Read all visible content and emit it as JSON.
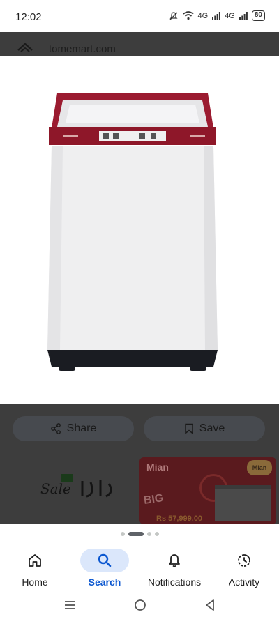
{
  "status_bar": {
    "time": "12:02",
    "network_1": "4G",
    "network_2": "4G",
    "battery": "80"
  },
  "source": {
    "site": "tomemart.com"
  },
  "actions": {
    "share_label": "Share",
    "save_label": "Save"
  },
  "related": {
    "sale_text": "Sale",
    "mian_title": "Mian",
    "mian_badge": "Mian",
    "mian_big": "BIG",
    "mian_price": "Rs 57,999.00"
  },
  "pager": {
    "count": 4,
    "active_index": 1
  },
  "bottom_nav": {
    "items": [
      {
        "label": "Home",
        "icon": "home-icon"
      },
      {
        "label": "Search",
        "icon": "search-icon",
        "active": true
      },
      {
        "label": "Notifications",
        "icon": "bell-icon"
      },
      {
        "label": "Activity",
        "icon": "activity-icon"
      }
    ]
  },
  "colors": {
    "accent": "#0b57d0",
    "active_pill": "#dbe7fb",
    "overlay": "#3d3d3d",
    "washer_lid": "#9b1b30"
  }
}
